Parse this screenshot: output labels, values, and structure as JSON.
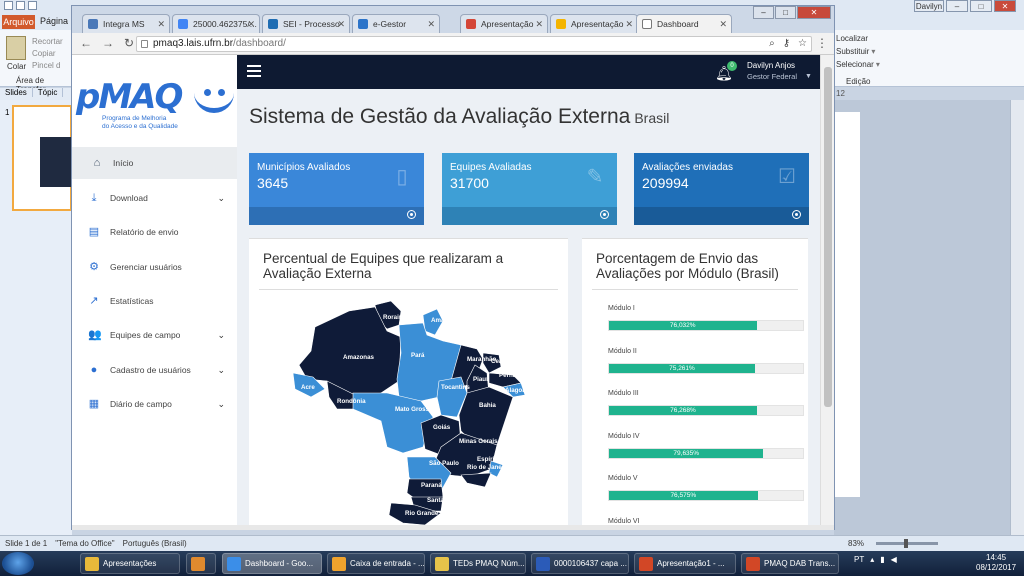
{
  "ppt": {
    "tab_arquivo": "Arquivo",
    "tab_pagina": "Página",
    "clipboard": [
      "Recortar",
      "Copiar",
      "Pincel d"
    ],
    "paste_label": "Colar",
    "clipboard_group": "Área de Transfer",
    "editing": [
      "Localizar",
      "Substituir",
      "Selecionar"
    ],
    "editing_group": "Edição",
    "panel_tabs": [
      "Slides",
      "Tópic"
    ],
    "slide_number": "1",
    "zoom_hint": "12",
    "status_left": [
      "Slide 1 de 1",
      "\"Tema do Office\"",
      "Português (Brasil)"
    ],
    "zoom": "83%",
    "user_badge": "Davilyn"
  },
  "taskbar": {
    "items": [
      {
        "label": "Apresentações",
        "color": "#e8b93a"
      },
      {
        "label": "",
        "color": "#e08a2e"
      },
      {
        "label": "Dashboard - Goo...",
        "color": "#3b8ee8"
      },
      {
        "label": "Caixa de entrada - ...",
        "color": "#f0a32d"
      },
      {
        "label": "TEDs PMAQ Núm...",
        "color": "#e6c34a"
      },
      {
        "label": "0000106437 capa ...",
        "color": "#2b5bb8"
      },
      {
        "label": "Apresentação1 - ...",
        "color": "#d24726"
      },
      {
        "label": "PMAQ DAB Trans...",
        "color": "#d24726"
      }
    ],
    "lang": "PT",
    "time": "14:45",
    "date": "08/12/2017"
  },
  "browser": {
    "tabs": [
      {
        "title": "Integra MS",
        "color": "#4a78b8"
      },
      {
        "title": "25000.462375/...",
        "color": "#4285f4"
      },
      {
        "title": "SEI - Processo",
        "color": "#1f6db3"
      },
      {
        "title": "e-Gestor",
        "color": "#2c74c9"
      },
      {
        "title": "Apresentação",
        "color": "#d44638"
      },
      {
        "title": "Apresentação",
        "color": "#f4b400"
      },
      {
        "title": "Dashboard",
        "color": "#ffffff"
      }
    ],
    "url_host": "pmaq3.lais.ufrn.br",
    "url_path": "/dashboard/"
  },
  "app": {
    "logo_word": "pMAQ",
    "logo_tagline_1": "Programa de Melhoria",
    "logo_tagline_2": "do Acesso e da Qualidade",
    "menu": [
      {
        "label": "Início",
        "icon": "home-icon",
        "glyph": "⌂",
        "chev": false
      },
      {
        "label": "Download",
        "icon": "download-icon",
        "glyph": "⤓",
        "chev": true
      },
      {
        "label": "Relatório de envio",
        "icon": "file-icon",
        "glyph": "▤",
        "chev": false
      },
      {
        "label": "Gerenciar usuários",
        "icon": "gear-icon",
        "glyph": "⚙",
        "chev": false
      },
      {
        "label": "Estatísticas",
        "icon": "chart-icon",
        "glyph": "↗",
        "chev": false
      },
      {
        "label": "Equipes de campo",
        "icon": "users-icon",
        "glyph": "👥",
        "chev": true
      },
      {
        "label": "Cadastro de usuários",
        "icon": "user-icon",
        "glyph": "●",
        "chev": true
      },
      {
        "label": "Diário de campo",
        "icon": "calendar-icon",
        "glyph": "▦",
        "chev": true
      }
    ],
    "notifications": "0",
    "user_name": "Davilyn Anjos",
    "user_role": "Gestor Federal",
    "title": "Sistema de Gestão da Avaliação Externa",
    "subtitle": "Brasil",
    "cards": [
      {
        "label": "Municípios Avaliados",
        "value": "3645",
        "color": "#3a87d9",
        "foot": "#2d6fb5",
        "icon": "file-icon",
        "glyph": "▯"
      },
      {
        "label": "Equipes Avaliadas",
        "value": "31700",
        "color": "#3e9fd6",
        "foot": "#2e82b6",
        "icon": "edit-icon",
        "glyph": "✎"
      },
      {
        "label": "Avaliações enviadas",
        "value": "209994",
        "color": "#1f6fb8",
        "foot": "#195b98",
        "icon": "check-icon",
        "glyph": "☑"
      }
    ],
    "map_title": "Percentual de Equipes que realizaram a Avaliação Externa",
    "bars_title": "Porcentagem de Envio das Avaliações por Módulo (Brasil)",
    "states": [
      "Roraima",
      "Amapá",
      "Amazonas",
      "Pará",
      "Maranhão",
      "Ceará",
      "Piauí",
      "Pernambuco",
      "Alagoas",
      "Acre",
      "Rondônia",
      "Tocantins",
      "Bahia",
      "Mato Grosso",
      "Goiás",
      "Minas Gerais",
      "Espírito Santo",
      "São Paulo",
      "Rio de Janeiro",
      "Paraná",
      "Santa Catarina",
      "Rio Grande do Sul"
    ],
    "map_colors": {
      "dark": "#0f1b38",
      "light": "#3b8fd6"
    },
    "modules": [
      {
        "label": "Módulo I",
        "pct": 76.032,
        "text": "76,032%"
      },
      {
        "label": "Módulo II",
        "pct": 75.261,
        "text": "75,261%"
      },
      {
        "label": "Módulo III",
        "pct": 76.268,
        "text": "76,268%"
      },
      {
        "label": "Módulo IV",
        "pct": 79.635,
        "text": "79,635%"
      },
      {
        "label": "Módulo V",
        "pct": 76.575,
        "text": "76,575%"
      },
      {
        "label": "Módulo VI",
        "pct": null,
        "text": ""
      }
    ]
  }
}
